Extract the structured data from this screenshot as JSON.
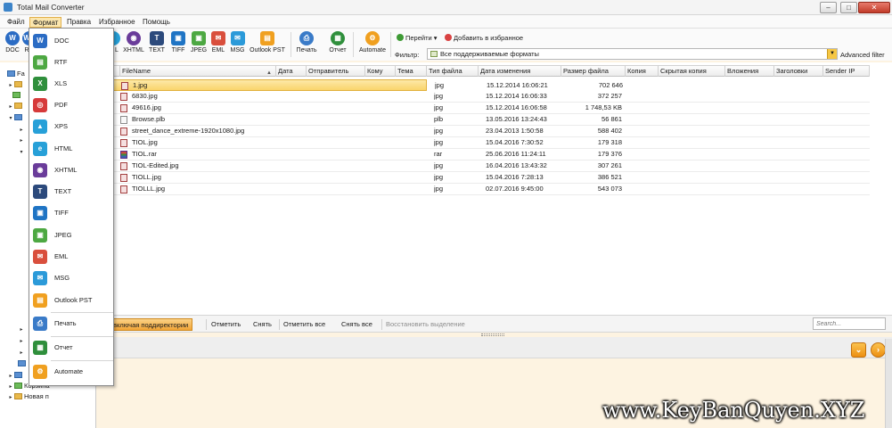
{
  "window": {
    "title": "Total Mail Converter",
    "controls": [
      "–",
      "□",
      "✕"
    ]
  },
  "menu": {
    "items": [
      "Файл",
      "Формат",
      "Правка",
      "Избранное",
      "Помощь"
    ],
    "active": "Формат"
  },
  "toolbar": {
    "formats_visible": [
      {
        "label": "DOC",
        "icon": "W",
        "color": "#2b6cc4"
      },
      {
        "label": "R",
        "icon": "W",
        "color": "#2b6cc4"
      },
      {
        "label": "L",
        "icon": "◉",
        "color": "#6a3c9a"
      },
      {
        "label": "XHTML",
        "icon": "◉",
        "color": "#6a3c9a"
      },
      {
        "label": "TEXT",
        "icon": "T",
        "color": "#2c4a7c"
      },
      {
        "label": "TIFF",
        "icon": "▣",
        "color": "#1f74c4"
      },
      {
        "label": "JPEG",
        "icon": "▣",
        "color": "#4da842"
      },
      {
        "label": "EML",
        "icon": "✉",
        "color": "#d94f3d"
      },
      {
        "label": "MSG",
        "icon": "✉",
        "color": "#2b9ad9"
      },
      {
        "label": "Outlook PST",
        "icon": "▤",
        "color": "#f0a020"
      }
    ],
    "print": "Печать",
    "report": "Отчет",
    "automate": "Automate",
    "goto": "Перейти",
    "add_favorite": "Добавить в избранное"
  },
  "filter": {
    "label": "Фильтр:",
    "value": "Все поддерживаемые форматы",
    "advanced": "Advanced filter"
  },
  "format_menu": {
    "items": [
      {
        "label": "DOC",
        "icon": "W",
        "color": "#2b6cc4"
      },
      {
        "label": "RTF",
        "icon": "▤",
        "color": "#4da842"
      },
      {
        "label": "XLS",
        "icon": "X",
        "color": "#2f8f3c"
      },
      {
        "label": "PDF",
        "icon": "◎",
        "color": "#d63a3a"
      },
      {
        "label": "XPS",
        "icon": "▲",
        "color": "#27a0d8"
      },
      {
        "label": "HTML",
        "icon": "e",
        "color": "#27a0d8"
      },
      {
        "label": "XHTML",
        "icon": "◉",
        "color": "#6a3c9a"
      },
      {
        "label": "TEXT",
        "icon": "T",
        "color": "#2c4a7c"
      },
      {
        "label": "TIFF",
        "icon": "▣",
        "color": "#1f74c4"
      },
      {
        "label": "JPEG",
        "icon": "▣",
        "color": "#4da842"
      },
      {
        "label": "EML",
        "icon": "✉",
        "color": "#d94f3d"
      },
      {
        "label": "MSG",
        "icon": "✉",
        "color": "#2b9ad9"
      },
      {
        "label": "Outlook PST",
        "icon": "▤",
        "color": "#f0a020"
      },
      {
        "label": "Печать",
        "icon": "⎙",
        "color": "#3a7bc8"
      },
      {
        "label": "Отчет",
        "icon": "▦",
        "color": "#2f8f3c"
      },
      {
        "label": "Automate",
        "icon": "⚙",
        "color": "#f0a020"
      }
    ]
  },
  "tree": {
    "items": [
      "Fa",
      "Корзина",
      "Новая п"
    ]
  },
  "columns": [
    "FileName",
    "Дата",
    "Отправитель",
    "Кому",
    "Тема",
    "Тип файла",
    "Дата изменения",
    "Размер файла",
    "Копия",
    "Скрытая копия",
    "Вложения",
    "Заголовки",
    "Sender IP"
  ],
  "files": [
    {
      "name": "1.jpg",
      "type": "jpg",
      "modified": "15.12.2014 16:06:21",
      "size": "702 646",
      "kind": "img"
    },
    {
      "name": "6830.jpg",
      "type": "jpg",
      "modified": "15.12.2014 16:06:33",
      "size": "372 257",
      "kind": "img"
    },
    {
      "name": "49616.jpg",
      "type": "jpg",
      "modified": "15.12.2014 16:06:58",
      "size": "1 748,53 KB",
      "kind": "img"
    },
    {
      "name": "Browse.plb",
      "type": "plb",
      "modified": "13.05.2016 13:24:43",
      "size": "56 861",
      "kind": "doc"
    },
    {
      "name": "street_dance_extreme-1920x1080.jpg",
      "type": "jpg",
      "modified": "23.04.2013 1:50:58",
      "size": "588 402",
      "kind": "img"
    },
    {
      "name": "TIOL.jpg",
      "type": "jpg",
      "modified": "15.04.2016 7:30:52",
      "size": "179 318",
      "kind": "img"
    },
    {
      "name": "TIOL.rar",
      "type": "rar",
      "modified": "25.06.2016 11:24:11",
      "size": "179 376",
      "kind": "rar"
    },
    {
      "name": "TIOL-Edited.jpg",
      "type": "jpg",
      "modified": "16.04.2016 13:43:32",
      "size": "307 261",
      "kind": "img"
    },
    {
      "name": "TIOLL.jpg",
      "type": "jpg",
      "modified": "15.04.2016 7:28:13",
      "size": "386 521",
      "kind": "img"
    },
    {
      "name": "TIOLLL.jpg",
      "type": "jpg",
      "modified": "02.07.2016 9:45:00",
      "size": "543 073",
      "kind": "img"
    }
  ],
  "bottom_bar": {
    "include_subdirs": "включая поддиректории",
    "check": "Отметить",
    "uncheck": "Снять",
    "check_all": "Отметить все",
    "uncheck_all": "Снять все",
    "restore_selection": "Восстановить выделение",
    "search_placeholder": "Search..."
  },
  "watermark": "www.KeyBanQuyen.XYZ",
  "colors": {
    "accent_orange": "#f2a436",
    "selection": "#f9d46b",
    "preview_bg": "#fdf3e1"
  }
}
